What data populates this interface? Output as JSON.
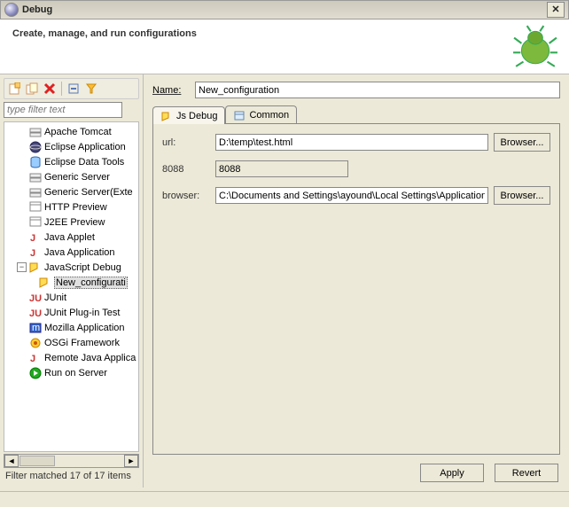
{
  "window": {
    "title": "Debug"
  },
  "banner": {
    "title": "Create, manage, and run configurations"
  },
  "filter": {
    "placeholder": "type filter text"
  },
  "tree": {
    "items": [
      {
        "label": "Apache Tomcat",
        "icon": "server-icon"
      },
      {
        "label": "Eclipse Application",
        "icon": "eclipse-icon"
      },
      {
        "label": "Eclipse Data Tools",
        "icon": "db-icon"
      },
      {
        "label": "Generic Server",
        "icon": "server-icon"
      },
      {
        "label": "Generic Server(Exte",
        "icon": "server-icon"
      },
      {
        "label": "HTTP Preview",
        "icon": "preview-icon"
      },
      {
        "label": "J2EE Preview",
        "icon": "preview-icon"
      },
      {
        "label": "Java Applet",
        "icon": "java-icon"
      },
      {
        "label": "Java Application",
        "icon": "java-icon"
      },
      {
        "label": "JavaScript Debug",
        "icon": "js-icon",
        "expanded": true
      },
      {
        "label": "New_configurati",
        "icon": "js-icon",
        "child": true,
        "selected": true
      },
      {
        "label": "JUnit",
        "icon": "junit-icon"
      },
      {
        "label": "JUnit Plug-in Test",
        "icon": "junit-icon"
      },
      {
        "label": "Mozilla Application",
        "icon": "mozilla-icon"
      },
      {
        "label": "OSGi Framework",
        "icon": "osgi-icon"
      },
      {
        "label": "Remote Java Applica",
        "icon": "java-icon"
      },
      {
        "label": "Run on Server",
        "icon": "run-icon"
      }
    ]
  },
  "status": {
    "text": "Filter matched 17 of 17 items"
  },
  "form": {
    "name_label": "Name:",
    "name_value": "New_configuration",
    "tabs": {
      "jsdebug": "Js Debug",
      "common": "Common"
    },
    "url_label": "url:",
    "url_value": "D:\\temp\\test.html",
    "port_label": "8088",
    "port_value": "8088",
    "browser_label": "browser:",
    "browser_value": "C:\\Documents and Settings\\ayound\\Local Settings\\Application Data",
    "browse_btn": "Browser...",
    "apply": "Apply",
    "revert": "Revert"
  }
}
